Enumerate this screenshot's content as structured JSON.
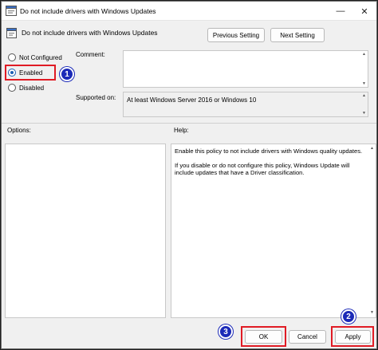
{
  "window": {
    "title": "Do not include drivers with Windows Updates",
    "minimize_glyph": "—",
    "close_glyph": "✕"
  },
  "header": {
    "title": "Do not include drivers with Windows Updates",
    "prev_label": "Previous Setting",
    "next_label": "Next Setting"
  },
  "options": {
    "not_configured": "Not Configured",
    "enabled": "Enabled",
    "disabled": "Disabled",
    "selected": "Enabled"
  },
  "fields": {
    "comment_label": "Comment:",
    "comment_value": "",
    "supported_label": "Supported on:",
    "supported_value": "At least Windows Server 2016 or Windows 10"
  },
  "panels": {
    "options_label": "Options:",
    "help_label": "Help:",
    "help_text_1": "Enable this policy to not include drivers with Windows quality updates.",
    "help_text_2": "If you disable or do not configure this policy, Windows Update will include updates that have a Driver classification."
  },
  "footer": {
    "ok_label": "OK",
    "cancel_label": "Cancel",
    "apply_label": "Apply"
  },
  "annotations": {
    "badge_1": "1",
    "badge_2": "2",
    "badge_3": "3",
    "highlight_color": "#e01b24",
    "badge_color": "#1b2ab8"
  },
  "icons": {
    "app": "policy-settings-icon",
    "header": "policy-settings-icon"
  }
}
